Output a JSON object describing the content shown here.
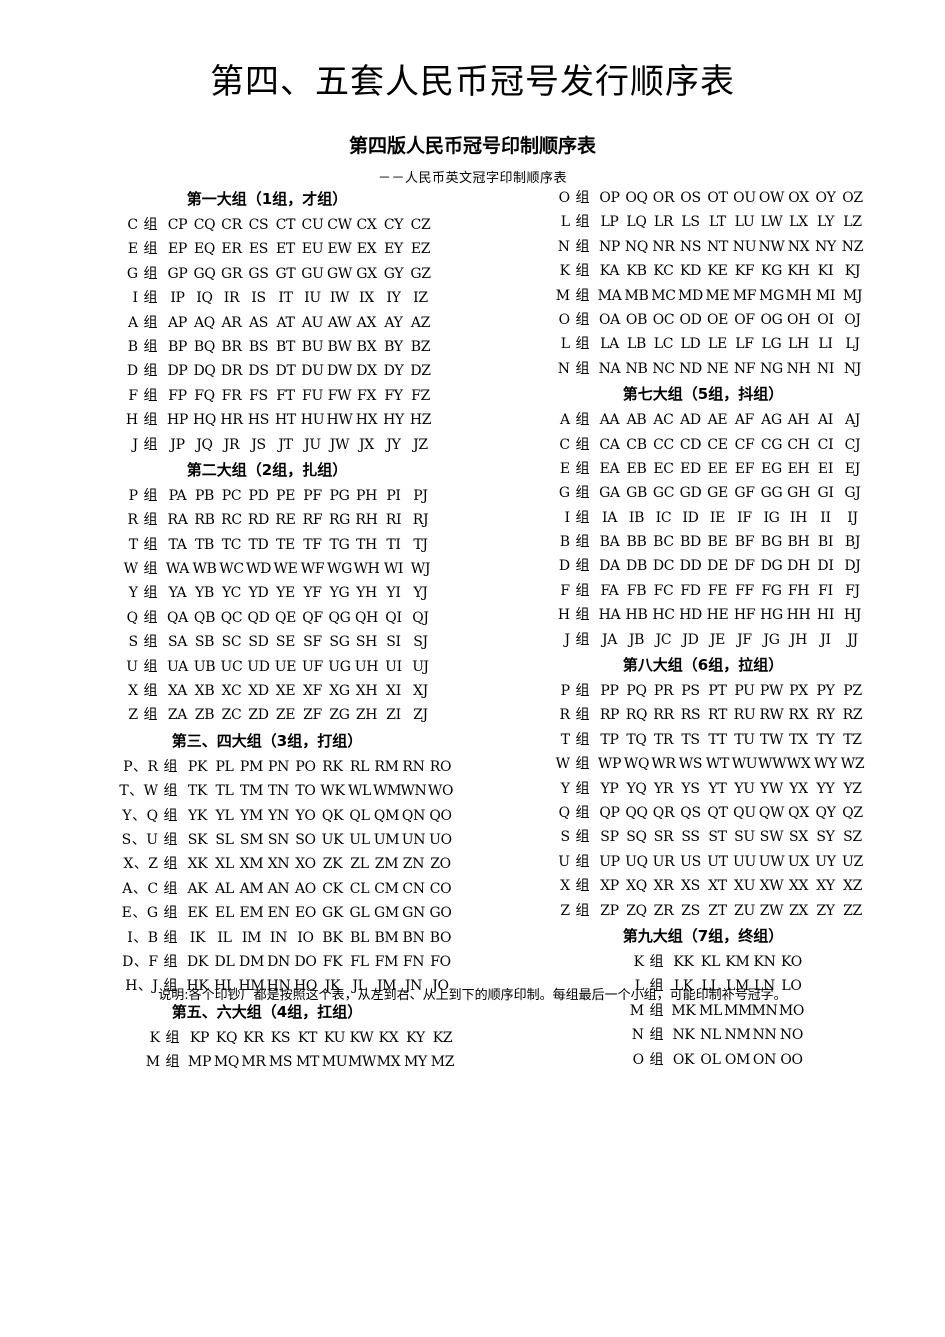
{
  "document": {
    "main_title": "第四、五套人民币冠号发行顺序表",
    "sub_title": "第四版人民币冠号印制顺序表",
    "sub_sub_title": "－－人民币英文冠字印制顺序表",
    "footnote": "说明:各个印钞厂都是按照这个表，从左到右、从上到下的顺序印制。每组最后一个小组，可能印制补号冠字。"
  },
  "left_column": [
    {
      "heading": "第一大组（1组，才组）",
      "indent": 0,
      "label_width": "normal",
      "rows": [
        {
          "label": "C 组",
          "cells": [
            "CP",
            "CQ",
            "CR",
            "CS",
            "CT",
            "CU",
            "CW",
            "CX",
            "CY",
            "CZ"
          ]
        },
        {
          "label": "E 组",
          "cells": [
            "EP",
            "EQ",
            "ER",
            "ES",
            "ET",
            "EU",
            "EW",
            "EX",
            "EY",
            "EZ"
          ]
        },
        {
          "label": "G 组",
          "cells": [
            "GP",
            "GQ",
            "GR",
            "GS",
            "GT",
            "GU",
            "GW",
            "GX",
            "GY",
            "GZ"
          ]
        },
        {
          "label": "I 组",
          "cells": [
            "IP",
            "IQ",
            "IR",
            "IS",
            "IT",
            "IU",
            "IW",
            "IX",
            "IY",
            "IZ"
          ]
        },
        {
          "label": "A 组",
          "cells": [
            "AP",
            "AQ",
            "AR",
            "AS",
            "AT",
            "AU",
            "AW",
            "AX",
            "AY",
            "AZ"
          ]
        },
        {
          "label": "B 组",
          "cells": [
            "BP",
            "BQ",
            "BR",
            "BS",
            "BT",
            "BU",
            "BW",
            "BX",
            "BY",
            "BZ"
          ]
        },
        {
          "label": "D 组",
          "cells": [
            "DP",
            "DQ",
            "DR",
            "DS",
            "DT",
            "DU",
            "DW",
            "DX",
            "DY",
            "DZ"
          ]
        },
        {
          "label": "F 组",
          "cells": [
            "FP",
            "FQ",
            "FR",
            "FS",
            "FT",
            "FU",
            "FW",
            "FX",
            "FY",
            "FZ"
          ]
        },
        {
          "label": "H 组",
          "cells": [
            "HP",
            "HQ",
            "HR",
            "HS",
            "HT",
            "HU",
            "HW",
            "HX",
            "HY",
            "HZ"
          ]
        },
        {
          "label": "J 组",
          "cells": [
            "JP",
            "JQ",
            "JR",
            "JS",
            "JT",
            "JU",
            "JW",
            "JX",
            "JY",
            "JZ"
          ]
        }
      ]
    },
    {
      "heading": "第二大组（2组，扎组）",
      "indent": 0,
      "label_width": "normal",
      "rows": [
        {
          "label": "P 组",
          "cells": [
            "PA",
            "PB",
            "PC",
            "PD",
            "PE",
            "PF",
            "PG",
            "PH",
            "PI",
            "PJ"
          ]
        },
        {
          "label": "R 组",
          "cells": [
            "RA",
            "RB",
            "RC",
            "RD",
            "RE",
            "RF",
            "RG",
            "RH",
            "RI",
            "RJ"
          ]
        },
        {
          "label": "T 组",
          "cells": [
            "TA",
            "TB",
            "TC",
            "TD",
            "TE",
            "TF",
            "TG",
            "TH",
            "TI",
            "TJ"
          ]
        },
        {
          "label": "W 组",
          "cells": [
            "WA",
            "WB",
            "WC",
            "WD",
            "WE",
            "WF",
            "WG",
            "WH",
            "WI",
            "WJ"
          ]
        },
        {
          "label": "Y 组",
          "cells": [
            "YA",
            "YB",
            "YC",
            "YD",
            "YE",
            "YF",
            "YG",
            "YH",
            "YI",
            "YJ"
          ]
        },
        {
          "label": "Q 组",
          "cells": [
            "QA",
            "QB",
            "QC",
            "QD",
            "QE",
            "QF",
            "QG",
            "QH",
            "QI",
            "QJ"
          ]
        },
        {
          "label": "S 组",
          "cells": [
            "SA",
            "SB",
            "SC",
            "SD",
            "SE",
            "SF",
            "SG",
            "SH",
            "SI",
            "SJ"
          ]
        },
        {
          "label": "U 组",
          "cells": [
            "UA",
            "UB",
            "UC",
            "UD",
            "UE",
            "UF",
            "UG",
            "UH",
            "UI",
            "UJ"
          ]
        },
        {
          "label": "X 组",
          "cells": [
            "XA",
            "XB",
            "XC",
            "XD",
            "XE",
            "XF",
            "XG",
            "XH",
            "XI",
            "XJ"
          ]
        },
        {
          "label": "Z 组",
          "cells": [
            "ZA",
            "ZB",
            "ZC",
            "ZD",
            "ZE",
            "ZF",
            "ZG",
            "ZH",
            "ZI",
            "ZJ"
          ]
        }
      ]
    },
    {
      "heading": "第三、四大组（3组，打组）",
      "indent": 0,
      "label_width": "wide",
      "rows": [
        {
          "label": "P、R 组",
          "cells": [
            "PK",
            "PL",
            "PM",
            "PN",
            "PO",
            "RK",
            "RL",
            "RM",
            "RN",
            "RO"
          ]
        },
        {
          "label": "T、W 组",
          "cells": [
            "TK",
            "TL",
            "TM",
            "TN",
            "TO",
            "WK",
            "WL",
            "WM",
            "WN",
            "WO"
          ]
        },
        {
          "label": "Y、Q 组",
          "cells": [
            "YK",
            "YL",
            "YM",
            "YN",
            "YO",
            "QK",
            "QL",
            "QM",
            "QN",
            "QO"
          ]
        },
        {
          "label": "S、U 组",
          "cells": [
            "SK",
            "SL",
            "SM",
            "SN",
            "SO",
            "UK",
            "UL",
            "UM",
            "UN",
            "UO"
          ]
        },
        {
          "label": "X、Z 组",
          "cells": [
            "XK",
            "XL",
            "XM",
            "XN",
            "XO",
            "ZK",
            "ZL",
            "ZM",
            "ZN",
            "ZO"
          ]
        },
        {
          "label": "A、C 组",
          "cells": [
            "AK",
            "AL",
            "AM",
            "AN",
            "AO",
            "CK",
            "CL",
            "CM",
            "CN",
            "CO"
          ]
        },
        {
          "label": "E、G 组",
          "cells": [
            "EK",
            "EL",
            "EM",
            "EN",
            "EO",
            "GK",
            "GL",
            "GM",
            "GN",
            "GO"
          ]
        },
        {
          "label": "I、B 组",
          "cells": [
            "IK",
            "IL",
            "IM",
            "IN",
            "IO",
            "BK",
            "BL",
            "BM",
            "BN",
            "BO"
          ]
        },
        {
          "label": "D、F 组",
          "cells": [
            "DK",
            "DL",
            "DM",
            "DN",
            "DO",
            "FK",
            "FL",
            "FM",
            "FN",
            "FO"
          ]
        },
        {
          "label": "H、J 组",
          "cells": [
            "HK",
            "HL",
            "HM",
            "HN",
            "HO",
            "JK",
            "JL",
            "JM",
            "JN",
            "JO"
          ]
        }
      ]
    },
    {
      "heading": "第五、六大组（4组，扛组）",
      "indent": 1,
      "label_width": "normal",
      "rows": [
        {
          "label": "K 组",
          "cells": [
            "KP",
            "KQ",
            "KR",
            "KS",
            "KT",
            "KU",
            "KW",
            "KX",
            "KY",
            "KZ"
          ]
        },
        {
          "label": "M 组",
          "cells": [
            "MP",
            "MQ",
            "MR",
            "MS",
            "MT",
            "MU",
            "MW",
            "MX",
            "MY",
            "MZ"
          ]
        }
      ]
    }
  ],
  "right_column": [
    {
      "heading": "",
      "indent": 0,
      "label_width": "normal",
      "rows": [
        {
          "label": "O 组",
          "cells": [
            "OP",
            "OQ",
            "OR",
            "OS",
            "OT",
            "OU",
            "OW",
            "OX",
            "OY",
            "OZ"
          ]
        },
        {
          "label": "L 组",
          "cells": [
            "LP",
            "LQ",
            "LR",
            "LS",
            "LT",
            "LU",
            "LW",
            "LX",
            "LY",
            "LZ"
          ]
        },
        {
          "label": "N 组",
          "cells": [
            "NP",
            "NQ",
            "NR",
            "NS",
            "NT",
            "NU",
            "NW",
            "NX",
            "NY",
            "NZ"
          ]
        },
        {
          "label": "K 组",
          "cells": [
            "KA",
            "KB",
            "KC",
            "KD",
            "KE",
            "KF",
            "KG",
            "KH",
            "KI",
            "KJ"
          ]
        },
        {
          "label": "M 组",
          "cells": [
            "MA",
            "MB",
            "MC",
            "MD",
            "ME",
            "MF",
            "MG",
            "MH",
            "MI",
            "MJ"
          ]
        },
        {
          "label": "O 组",
          "cells": [
            "OA",
            "OB",
            "OC",
            "OD",
            "OE",
            "OF",
            "OG",
            "OH",
            "OI",
            "OJ"
          ]
        },
        {
          "label": "L 组",
          "cells": [
            "LA",
            "LB",
            "LC",
            "LD",
            "LE",
            "LF",
            "LG",
            "LH",
            "LI",
            "LJ"
          ]
        },
        {
          "label": "N 组",
          "cells": [
            "NA",
            "NB",
            "NC",
            "ND",
            "NE",
            "NF",
            "NG",
            "NH",
            "NI",
            "NJ"
          ]
        }
      ]
    },
    {
      "heading": "第七大组（5组，抖组）",
      "indent": 0,
      "label_width": "normal",
      "rows": [
        {
          "label": "A 组",
          "cells": [
            "AA",
            "AB",
            "AC",
            "AD",
            "AE",
            "AF",
            "AG",
            "AH",
            "AI",
            "AJ"
          ]
        },
        {
          "label": "C 组",
          "cells": [
            "CA",
            "CB",
            "CC",
            "CD",
            "CE",
            "CF",
            "CG",
            "CH",
            "CI",
            "CJ"
          ]
        },
        {
          "label": "E 组",
          "cells": [
            "EA",
            "EB",
            "EC",
            "ED",
            "EE",
            "EF",
            "EG",
            "EH",
            "EI",
            "EJ"
          ]
        },
        {
          "label": "G 组",
          "cells": [
            "GA",
            "GB",
            "GC",
            "GD",
            "GE",
            "GF",
            "GG",
            "GH",
            "GI",
            "GJ"
          ]
        },
        {
          "label": "I 组",
          "cells": [
            "IA",
            "IB",
            "IC",
            "ID",
            "IE",
            "IF",
            "IG",
            "IH",
            "II",
            "IJ"
          ]
        },
        {
          "label": "B 组",
          "cells": [
            "BA",
            "BB",
            "BC",
            "BD",
            "BE",
            "BF",
            "BG",
            "BH",
            "BI",
            "BJ"
          ]
        },
        {
          "label": "D 组",
          "cells": [
            "DA",
            "DB",
            "DC",
            "DD",
            "DE",
            "DF",
            "DG",
            "DH",
            "DI",
            "DJ"
          ]
        },
        {
          "label": "F 组",
          "cells": [
            "FA",
            "FB",
            "FC",
            "FD",
            "FE",
            "FF",
            "FG",
            "FH",
            "FI",
            "FJ"
          ]
        },
        {
          "label": "H 组",
          "cells": [
            "HA",
            "HB",
            "HC",
            "HD",
            "HE",
            "HF",
            "HG",
            "HH",
            "HI",
            "HJ"
          ]
        },
        {
          "label": "J 组",
          "cells": [
            "JA",
            "JB",
            "JC",
            "JD",
            "JE",
            "JF",
            "JG",
            "JH",
            "JI",
            "JJ"
          ]
        }
      ]
    },
    {
      "heading": "第八大组（6组，拉组）",
      "indent": 0,
      "label_width": "normal",
      "rows": [
        {
          "label": "P 组",
          "cells": [
            "PP",
            "PQ",
            "PR",
            "PS",
            "PT",
            "PU",
            "PW",
            "PX",
            "PY",
            "PZ"
          ]
        },
        {
          "label": "R 组",
          "cells": [
            "RP",
            "RQ",
            "RR",
            "RS",
            "RT",
            "RU",
            "RW",
            "RX",
            "RY",
            "RZ"
          ]
        },
        {
          "label": "T 组",
          "cells": [
            "TP",
            "TQ",
            "TR",
            "TS",
            "TT",
            "TU",
            "TW",
            "TX",
            "TY",
            "TZ"
          ]
        },
        {
          "label": "W 组",
          "cells": [
            "WP",
            "WQ",
            "WR",
            "WS",
            "WT",
            "WU",
            "WW",
            "WX",
            "WY",
            "WZ"
          ]
        },
        {
          "label": "Y 组",
          "cells": [
            "YP",
            "YQ",
            "YR",
            "YS",
            "YT",
            "YU",
            "YW",
            "YX",
            "YY",
            "YZ"
          ]
        },
        {
          "label": "Q 组",
          "cells": [
            "QP",
            "QQ",
            "QR",
            "QS",
            "QT",
            "QU",
            "QW",
            "QX",
            "QY",
            "QZ"
          ]
        },
        {
          "label": "S 组",
          "cells": [
            "SP",
            "SQ",
            "SR",
            "SS",
            "ST",
            "SU",
            "SW",
            "SX",
            "SY",
            "SZ"
          ]
        },
        {
          "label": "U 组",
          "cells": [
            "UP",
            "UQ",
            "UR",
            "US",
            "UT",
            "UU",
            "UW",
            "UX",
            "UY",
            "UZ"
          ]
        },
        {
          "label": "X 组",
          "cells": [
            "XP",
            "XQ",
            "XR",
            "XS",
            "XT",
            "XU",
            "XW",
            "XX",
            "XY",
            "XZ"
          ]
        },
        {
          "label": "Z 组",
          "cells": [
            "ZP",
            "ZQ",
            "ZR",
            "ZS",
            "ZT",
            "ZU",
            "ZW",
            "ZX",
            "ZY",
            "ZZ"
          ]
        }
      ]
    },
    {
      "heading": "第九大组（7组，终组）",
      "indent": 2,
      "label_width": "normal",
      "rows": [
        {
          "label": "K 组",
          "cells": [
            "KK",
            "KL",
            "KM",
            "KN",
            "KO"
          ]
        },
        {
          "label": "L 组",
          "cells": [
            "LK",
            "LL",
            "LM",
            "LN",
            "LO"
          ]
        },
        {
          "label": "M 组",
          "cells": [
            "MK",
            "ML",
            "MM",
            "MN",
            "MO"
          ]
        },
        {
          "label": "N 组",
          "cells": [
            "NK",
            "NL",
            "NM",
            "NN",
            "NO"
          ]
        },
        {
          "label": "O 组",
          "cells": [
            "OK",
            "OL",
            "OM",
            "ON",
            "OO"
          ]
        }
      ]
    }
  ]
}
